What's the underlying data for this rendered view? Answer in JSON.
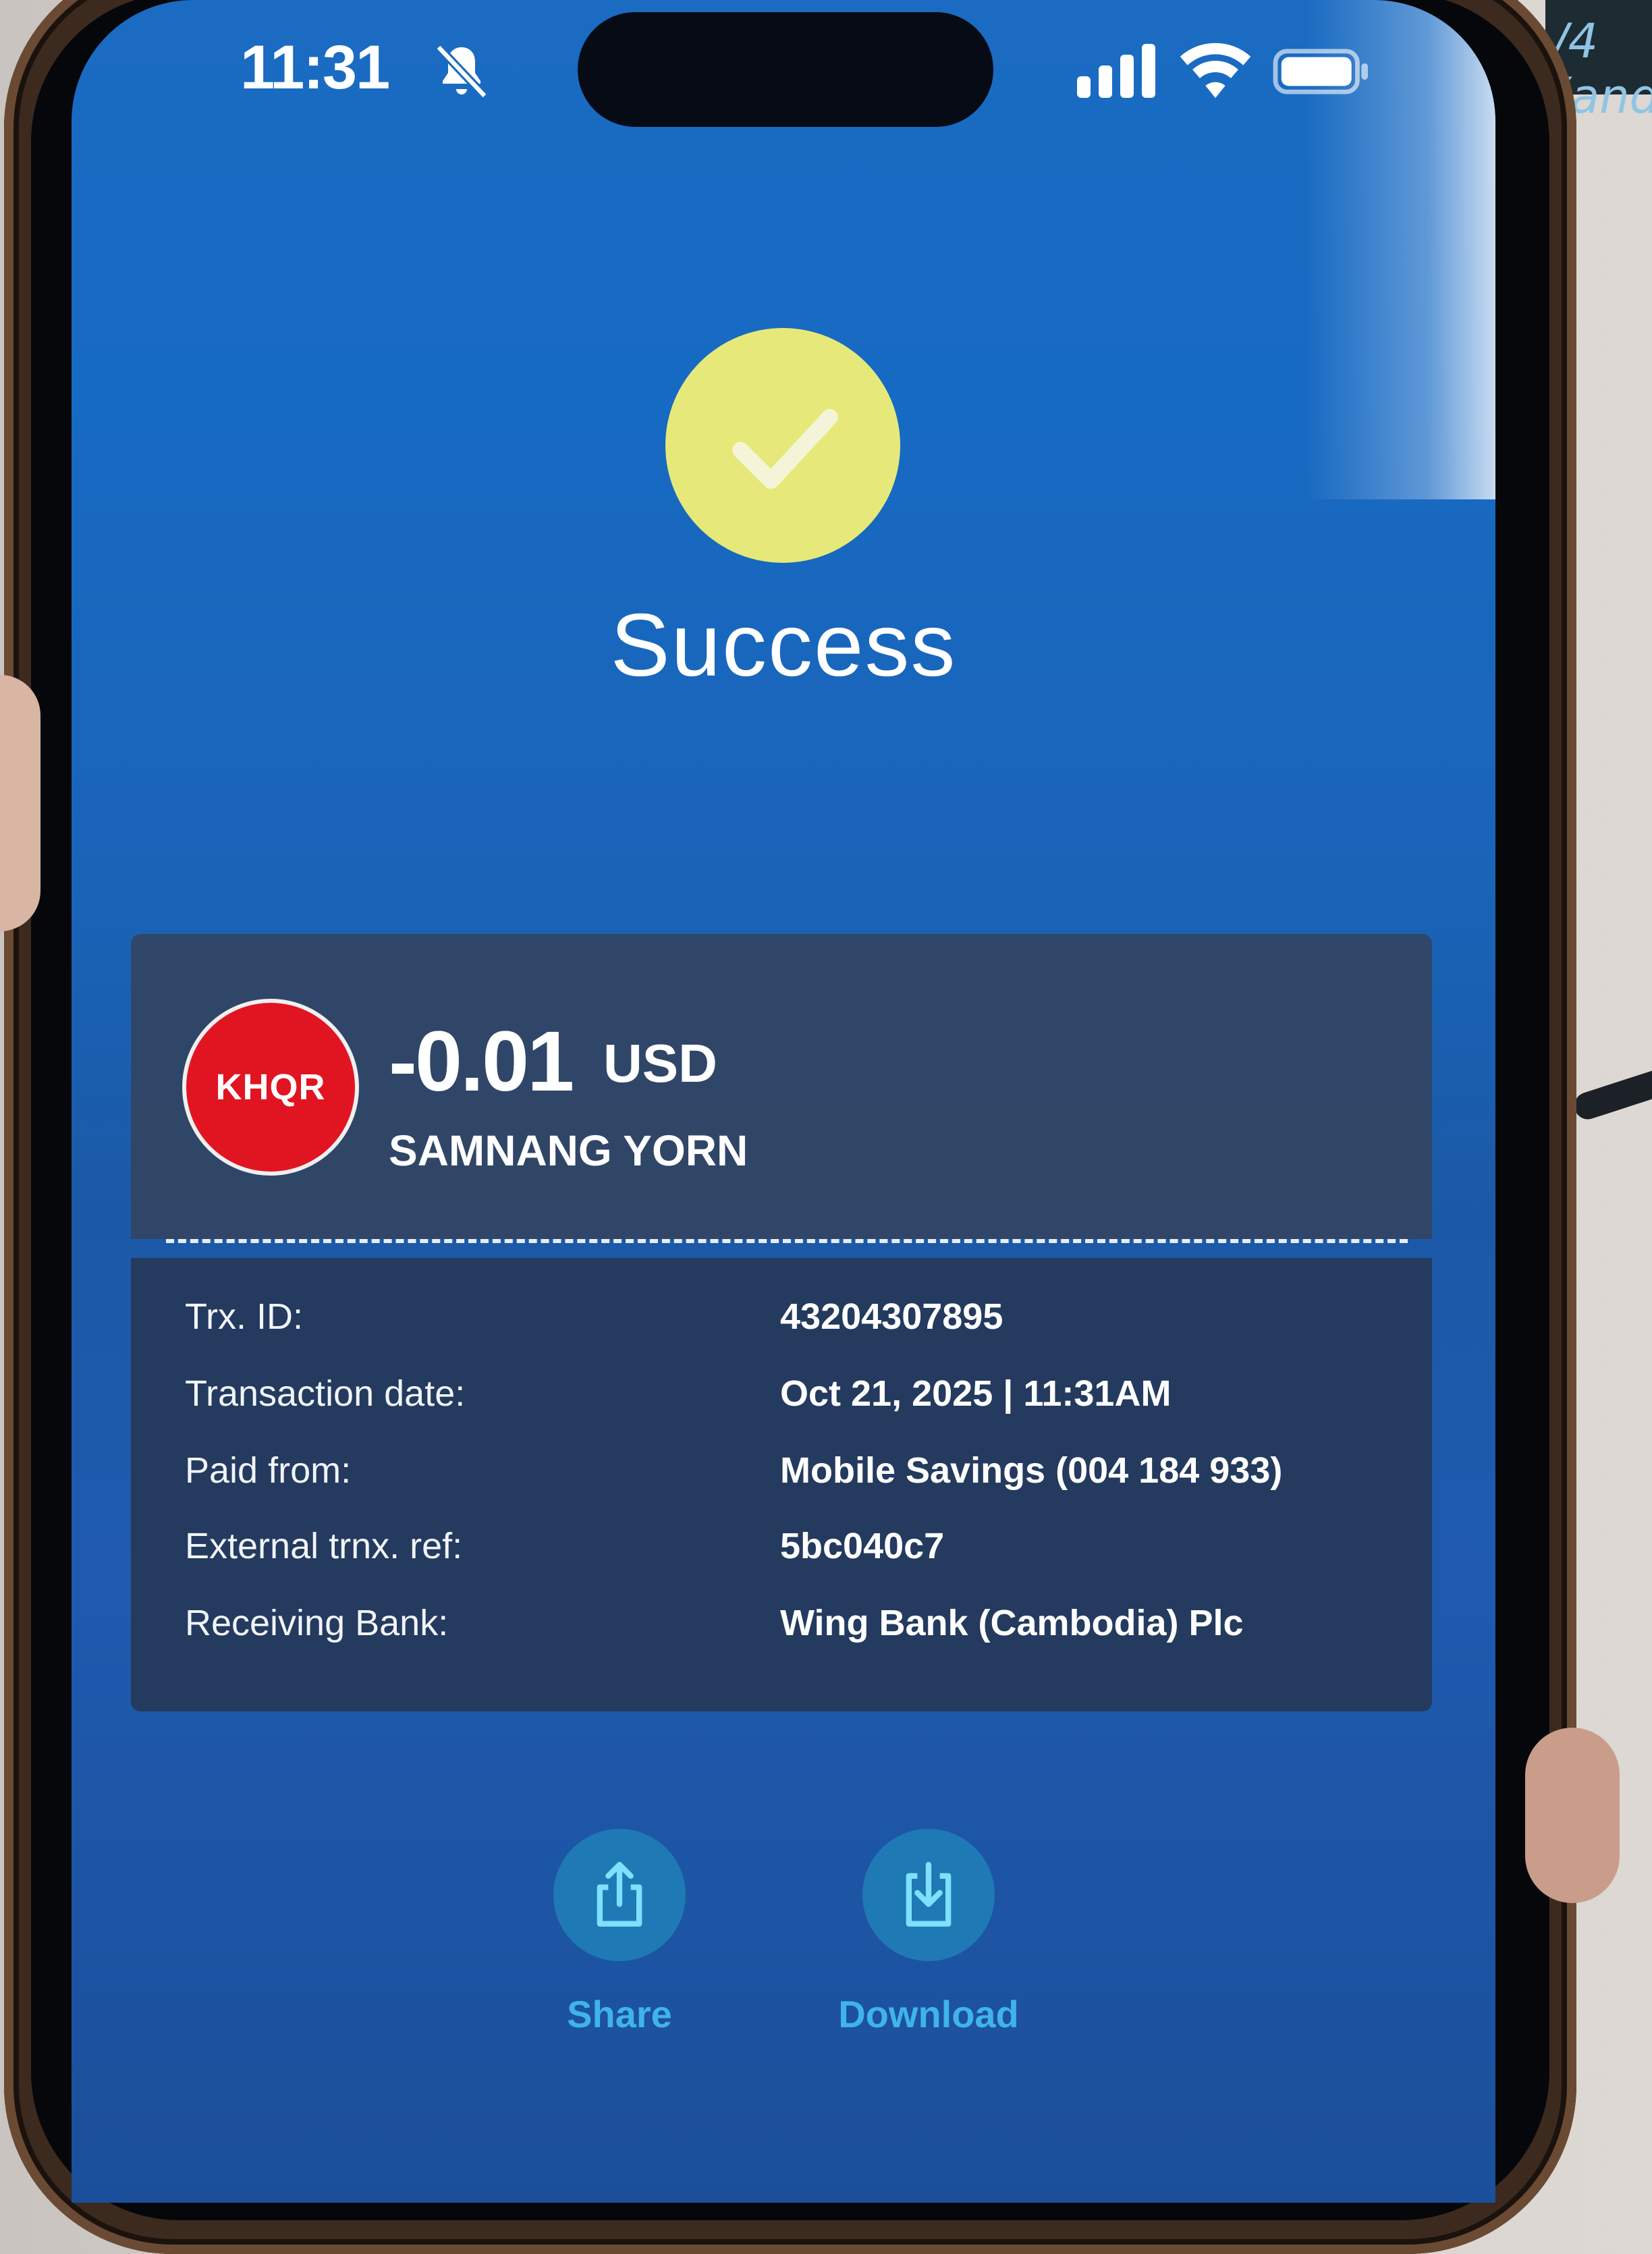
{
  "status_bar": {
    "time": "11:31",
    "icons": [
      "mute-bell-icon",
      "signal-icon",
      "wifi-icon",
      "battery-icon"
    ]
  },
  "success": {
    "icon": "check-icon",
    "title": "Success"
  },
  "transaction": {
    "logo_text": "KHQR",
    "amount": "-0.01",
    "currency": "USD",
    "payee": "SAMNANG YORN"
  },
  "details": {
    "rows": [
      {
        "label": "Trx. ID:",
        "value": "43204307895"
      },
      {
        "label": "Transaction date:",
        "value": "Oct 21, 2025 | 11:31AM"
      },
      {
        "label": "Paid from:",
        "value": "Mobile Savings (004 184 933)"
      },
      {
        "label": "External trnx. ref:",
        "value": "5bc040c7"
      },
      {
        "label": "Receiving Bank:",
        "value": "Wing Bank (Cambodia) Plc"
      }
    ]
  },
  "actions": {
    "share_label": "Share",
    "download_label": "Download"
  },
  "colors": {
    "screen_blue": "#1a64b8",
    "check_yellow": "#e6e97a",
    "khqr_red": "#e11522",
    "action_label": "#3fb4e8"
  }
}
